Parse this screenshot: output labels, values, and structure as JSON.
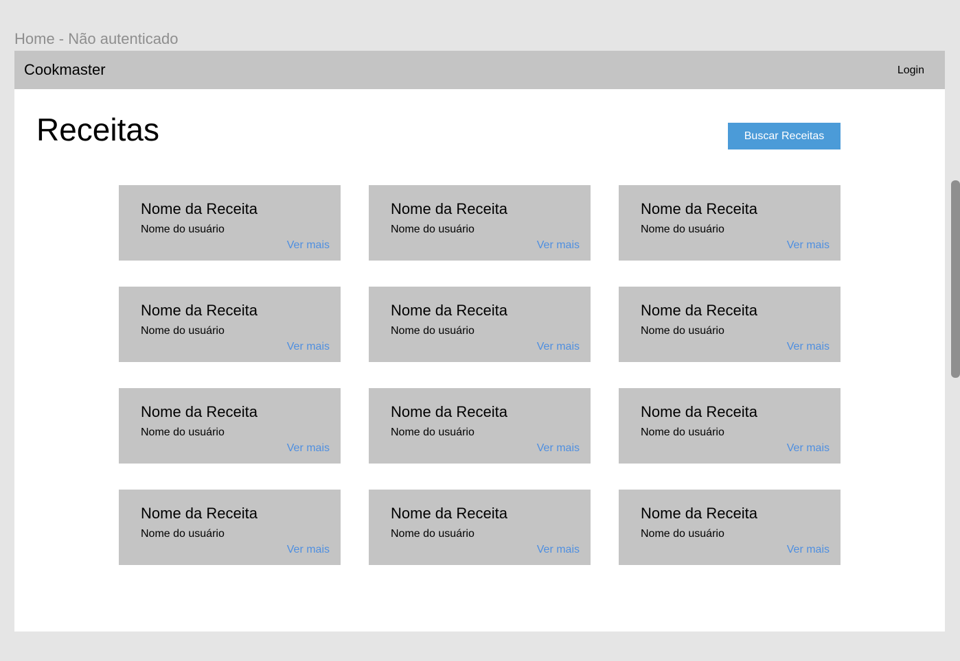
{
  "frame_label": "Home - Não autenticado",
  "navbar": {
    "brand": "Cookmaster",
    "login_label": "Login"
  },
  "main": {
    "title": "Receitas",
    "search_button_label": "Buscar Receitas"
  },
  "recipes": [
    {
      "name": "Nome da Receita",
      "user": "Nome do usuário",
      "link": "Ver mais"
    },
    {
      "name": "Nome da Receita",
      "user": "Nome do usuário",
      "link": "Ver mais"
    },
    {
      "name": "Nome da Receita",
      "user": "Nome do usuário",
      "link": "Ver mais"
    },
    {
      "name": "Nome da Receita",
      "user": "Nome do usuário",
      "link": "Ver mais"
    },
    {
      "name": "Nome da Receita",
      "user": "Nome do usuário",
      "link": "Ver mais"
    },
    {
      "name": "Nome da Receita",
      "user": "Nome do usuário",
      "link": "Ver mais"
    },
    {
      "name": "Nome da Receita",
      "user": "Nome do usuário",
      "link": "Ver mais"
    },
    {
      "name": "Nome da Receita",
      "user": "Nome do usuário",
      "link": "Ver mais"
    },
    {
      "name": "Nome da Receita",
      "user": "Nome do usuário",
      "link": "Ver mais"
    },
    {
      "name": "Nome da Receita",
      "user": "Nome do usuário",
      "link": "Ver mais"
    },
    {
      "name": "Nome da Receita",
      "user": "Nome do usuário",
      "link": "Ver mais"
    },
    {
      "name": "Nome da Receita",
      "user": "Nome do usuário",
      "link": "Ver mais"
    }
  ],
  "colors": {
    "canvas": "#e5e5e5",
    "navbar": "#c4c4c4",
    "card": "#c4c4c4",
    "button": "#4b9bd8",
    "link": "#4f8fe0"
  }
}
